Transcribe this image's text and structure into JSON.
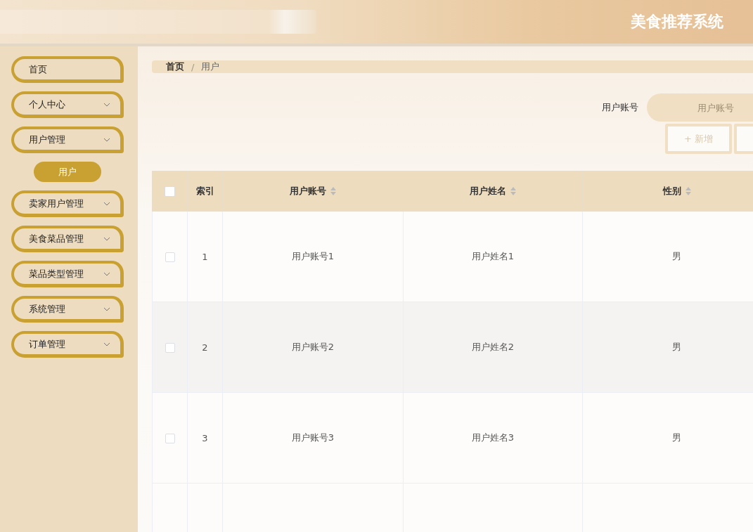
{
  "header": {
    "title": "美食推荐系统"
  },
  "sidebar": {
    "items": [
      {
        "label": "首页",
        "kind": "link"
      },
      {
        "label": "个人中心",
        "kind": "submenu"
      },
      {
        "label": "用户管理",
        "kind": "submenu",
        "children": [
          {
            "label": "用户",
            "selected": true
          }
        ]
      },
      {
        "label": "卖家用户管理",
        "kind": "submenu"
      },
      {
        "label": "美食菜品管理",
        "kind": "submenu"
      },
      {
        "label": "菜品类型管理",
        "kind": "submenu"
      },
      {
        "label": "系统管理",
        "kind": "submenu"
      },
      {
        "label": "订单管理",
        "kind": "submenu"
      }
    ]
  },
  "breadcrumb": [
    "首页",
    "用户"
  ],
  "breadcrumb_separator": "/",
  "search": {
    "label": "用户账号",
    "placeholder": "用户账号"
  },
  "toolbar": {
    "buttons": [
      {
        "label": "+ 新增"
      }
    ]
  },
  "table": {
    "select_all_checked": false,
    "columns": [
      {
        "label": "索引",
        "sortable": false
      },
      {
        "label": "用户账号",
        "sortable": true
      },
      {
        "label": "用户姓名",
        "sortable": true
      },
      {
        "label": "性别",
        "sortable": true
      }
    ],
    "rows": [
      {
        "checked": false,
        "cells": [
          "1",
          "用户账号1",
          "用户姓名1",
          "男"
        ]
      },
      {
        "checked": false,
        "cells": [
          "2",
          "用户账号2",
          "用户姓名2",
          "男"
        ]
      },
      {
        "checked": false,
        "cells": [
          "3",
          "用户账号3",
          "用户姓名3",
          "男"
        ]
      }
    ]
  }
}
